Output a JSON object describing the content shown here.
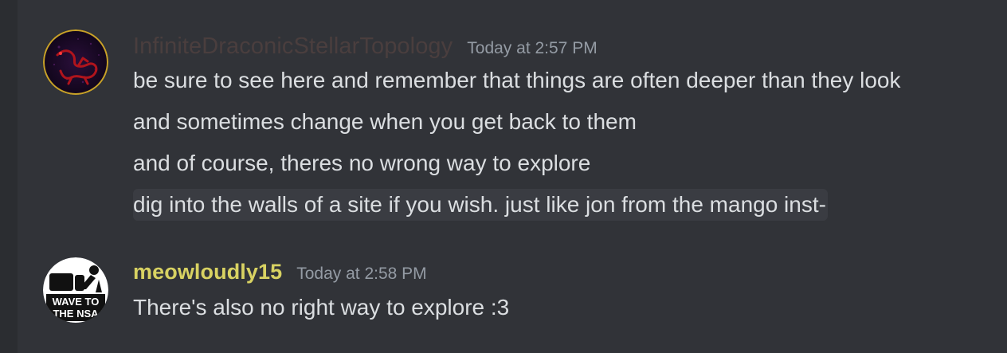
{
  "messages": [
    {
      "username": "InfiniteDraconicStellarTopology",
      "timestamp": "Today at 2:57 PM",
      "lines": [
        "be sure to see here and remember that things are often deeper than they look",
        "and sometimes change when you get back to them",
        "and of course, theres no wrong way to explore",
        "dig into the walls of a site if you wish. just like jon from the mango inst-"
      ],
      "username_color": "#4a3e3e",
      "avatar_icon": "red-dragon-icon"
    },
    {
      "username": "meowloudly15",
      "timestamp": "Today at 2:58 PM",
      "lines": [
        "There's also no right way to explore :3"
      ],
      "username_color": "#d8d262",
      "avatar_icon": "wave-to-the-nsa-icon",
      "avatar_text_1": "WAVE TO",
      "avatar_text_2": "THE NSA"
    }
  ],
  "colors": {
    "background": "#313338",
    "text": "#dbdee1",
    "timestamp": "#949ba4",
    "highlight": "#3a3c42"
  }
}
